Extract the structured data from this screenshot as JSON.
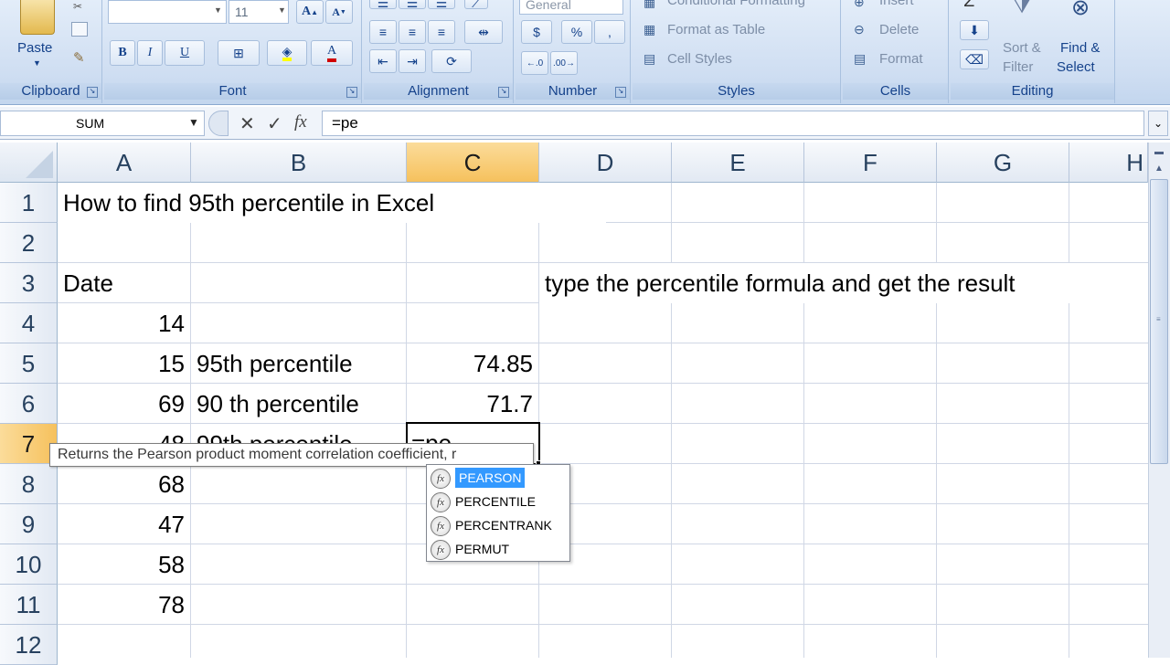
{
  "ribbon": {
    "clipboard": {
      "label": "Clipboard",
      "paste": "Paste"
    },
    "font": {
      "label": "Font",
      "size": "11",
      "bold": "B",
      "italic": "I",
      "underline": "U"
    },
    "alignment": {
      "label": "Alignment"
    },
    "number": {
      "label": "Number",
      "format": "General",
      "currency": "$",
      "percent": "%",
      "comma": ","
    },
    "styles": {
      "label": "Styles",
      "conditional": "Conditional Formatting",
      "format_table": "Format as Table",
      "cell_styles": "Cell Styles"
    },
    "cells": {
      "label": "Cells",
      "insert": "Insert",
      "delete": "Delete",
      "format": "Format"
    },
    "editing": {
      "label": "Editing",
      "sort_filter_1": "Sort &",
      "sort_filter_2": "Filter",
      "find_select_1": "Find &",
      "find_select_2": "Select"
    }
  },
  "formula_bar": {
    "name_box": "SUM",
    "formula": "=pe"
  },
  "columns": [
    "A",
    "B",
    "C",
    "D",
    "E",
    "F",
    "G",
    "H"
  ],
  "rows": [
    "1",
    "2",
    "3",
    "4",
    "5",
    "6",
    "7",
    "8",
    "9",
    "10",
    "11",
    "12"
  ],
  "cells": {
    "a1": "How to find 95th percentile in Excel",
    "a3": "Date",
    "d3": "type the percentile formula and get the result",
    "a4": "14",
    "a5": "15",
    "b5": "95th percentile",
    "c5": "74.85",
    "a6": "69",
    "b6": "90 th percentile",
    "c6": "71.7",
    "a7": "48",
    "b7": "99th percentile",
    "c7": "=pe",
    "a8": "68",
    "a9": "47",
    "a10": "58",
    "a11": "78"
  },
  "autocomplete": {
    "tooltip": "Returns the Pearson product moment correlation coefficient, r",
    "items": [
      "PEARSON",
      "PERCENTILE",
      "PERCENTRANK",
      "PERMUT"
    ]
  },
  "colors": {
    "selection_header": "#f6c15d",
    "highlight": "#3399ff",
    "ribbon_text": "#15428b"
  }
}
